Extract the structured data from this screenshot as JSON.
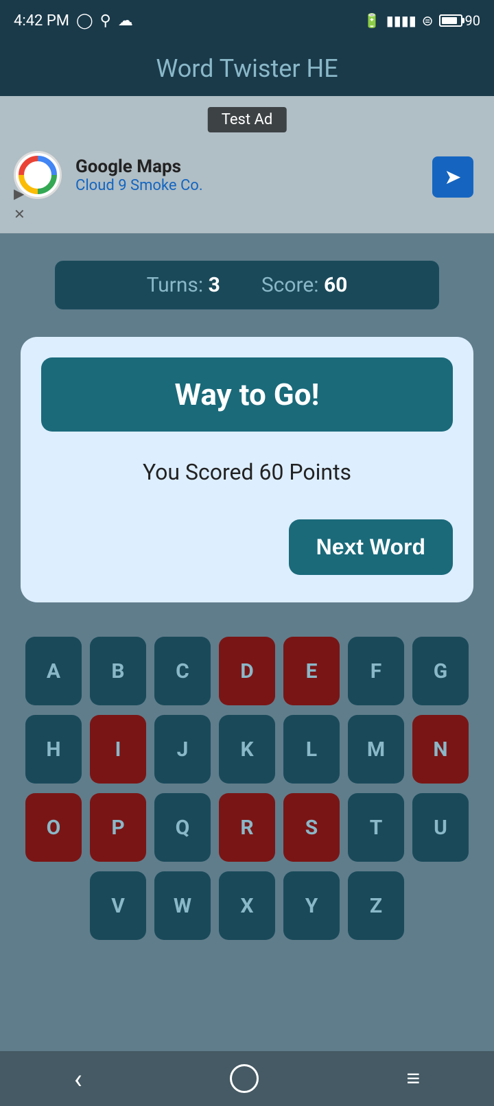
{
  "statusBar": {
    "time": "4:42 PM",
    "battery": "90"
  },
  "titleBar": {
    "title": "Word Twister HE"
  },
  "ad": {
    "label": "Test Ad",
    "name": "Google Maps",
    "sub": "Cloud 9 Smoke Co."
  },
  "scoreBar": {
    "turnsLabel": "Turns:",
    "turnsValue": "3",
    "scoreLabel": "Score:",
    "scoreValue": "60"
  },
  "modal": {
    "header": "Way to Go!",
    "scoreText": "You Scored 60 Points",
    "nextWordLabel": "Next Word"
  },
  "keyboard": {
    "rows": [
      [
        "A",
        "B",
        "C",
        "D",
        "E",
        "F",
        "G"
      ],
      [
        "H",
        "I",
        "J",
        "K",
        "L",
        "M",
        "N"
      ],
      [
        "O",
        "P",
        "Q",
        "R",
        "S",
        "T",
        "U"
      ],
      [
        "V",
        "W",
        "X",
        "Y",
        "Z"
      ]
    ],
    "usedKeys": [
      "D",
      "E",
      "I",
      "N",
      "O",
      "P",
      "R",
      "S"
    ]
  },
  "bottomNav": {
    "back": "‹",
    "home": "○",
    "menu": "≡"
  }
}
